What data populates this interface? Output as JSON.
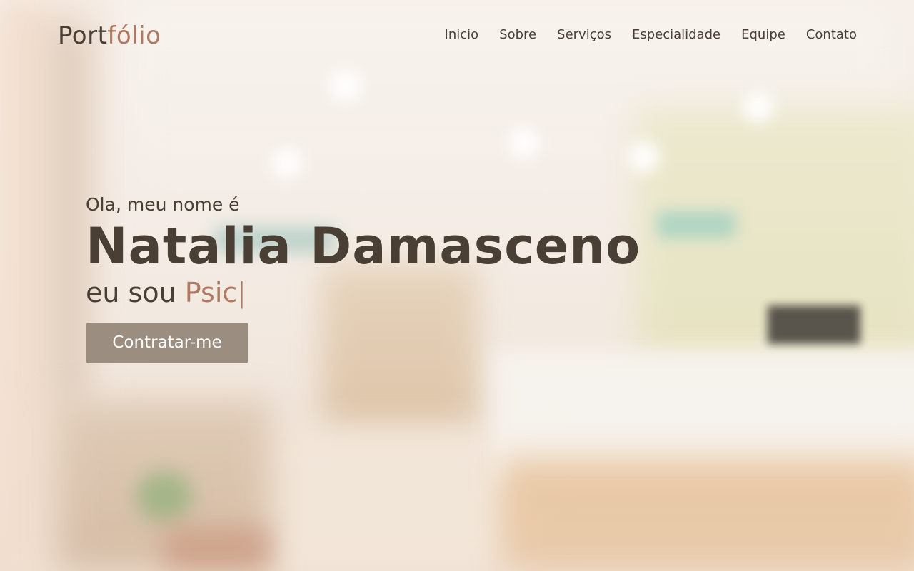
{
  "header": {
    "logo_main": "Port",
    "logo_accent": "fólio",
    "nav": [
      {
        "label": "Inicio"
      },
      {
        "label": "Sobre"
      },
      {
        "label": "Serviços"
      },
      {
        "label": "Especialidade"
      },
      {
        "label": "Equipe"
      },
      {
        "label": "Contato"
      }
    ]
  },
  "hero": {
    "greeting": "Ola, meu nome é",
    "name": "Natalia Damasceno",
    "role_prefix": "eu sou",
    "role_typed": "Psic",
    "cursor": "|",
    "cta_label": "Contratar-me"
  },
  "colors": {
    "text": "#4a3f35",
    "accent": "#b07a62",
    "button_bg": "#9b8d80",
    "button_text": "#ffffff"
  }
}
